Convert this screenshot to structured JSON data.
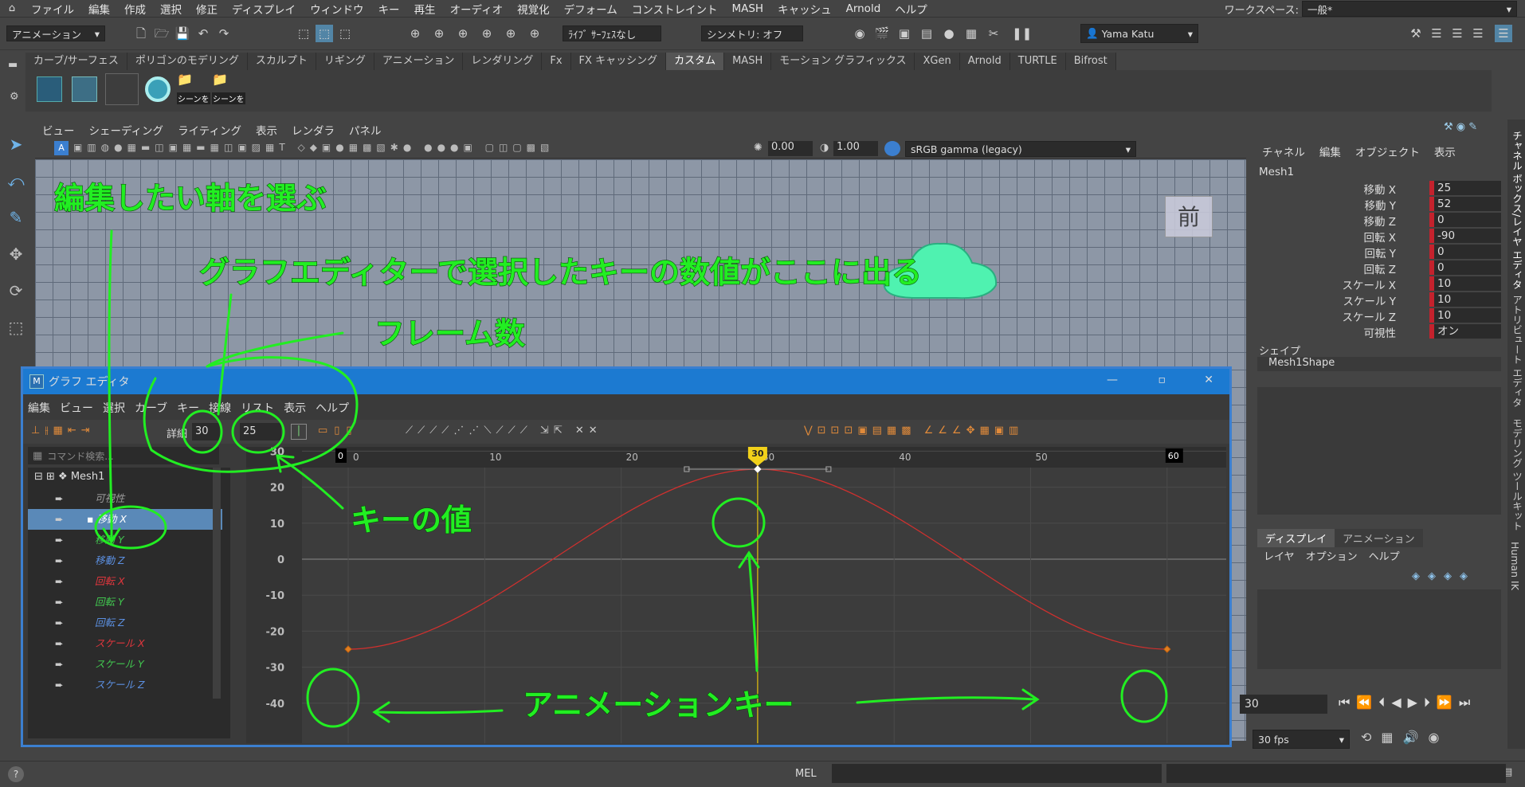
{
  "menubar": {
    "items": [
      "ファイル",
      "編集",
      "作成",
      "選択",
      "修正",
      "ディスプレイ",
      "ウィンドウ",
      "キー",
      "再生",
      "オーディオ",
      "視覚化",
      "デフォーム",
      "コンストレイント",
      "MASH",
      "キャッシュ",
      "Arnold",
      "ヘルプ"
    ],
    "workspace_label": "ワークスペース:",
    "workspace_value": "一般*"
  },
  "toolbar": {
    "mode": "アニメーション",
    "live": "ﾗｲﾌﾞ ｻｰﾌｪｽなし",
    "symmetry": "シンメトリ: オフ",
    "user": "Yama Katu"
  },
  "shelf": {
    "tabs": [
      "カーブ/サーフェス",
      "ポリゴンのモデリング",
      "スカルプト",
      "リギング",
      "アニメーション",
      "レンダリング",
      "Fx",
      "FX キャッシング",
      "カスタム",
      "MASH",
      "モーション グラフィックス",
      "XGen",
      "Arnold",
      "TURTLE",
      "Bifrost"
    ],
    "active": "カスタム",
    "icon_labels": [
      "シーンを",
      "シーンを"
    ]
  },
  "viewport": {
    "menu": [
      "ビュー",
      "シェーディング",
      "ライティング",
      "表示",
      "レンダラ",
      "パネル"
    ],
    "exposure": "0.00",
    "gamma": "1.00",
    "colorspace": "sRGB gamma (legacy)",
    "view_label": "前"
  },
  "graph_editor": {
    "title": "グラフ エディタ",
    "menu": [
      "編集",
      "ビュー",
      "選択",
      "カーブ",
      "キー",
      "接線",
      "リスト",
      "表示",
      "ヘルプ"
    ],
    "detail_label": "詳細",
    "frame_value": "30",
    "key_value": "25",
    "search_placeholder": "コマンド検索...",
    "tree": {
      "root": "Mesh1",
      "items": [
        {
          "label": "可視性",
          "color": "#9a9a9a",
          "selected": false
        },
        {
          "label": "移動 X",
          "color": "#ffffff",
          "selected": true
        },
        {
          "label": "移動 Y",
          "color": "#41c74f",
          "selected": false
        },
        {
          "label": "移動 Z",
          "color": "#5b8fe0",
          "selected": false
        },
        {
          "label": "回転 X",
          "color": "#e0363d",
          "selected": false
        },
        {
          "label": "回転 Y",
          "color": "#41c74f",
          "selected": false
        },
        {
          "label": "回転 Z",
          "color": "#5b8fe0",
          "selected": false
        },
        {
          "label": "スケール X",
          "color": "#e0363d",
          "selected": false
        },
        {
          "label": "スケール Y",
          "color": "#41c74f",
          "selected": false
        },
        {
          "label": "スケール Z",
          "color": "#5b8fe0",
          "selected": false
        }
      ]
    },
    "x_ticks": [
      "0",
      "10",
      "20",
      "30",
      "40",
      "50"
    ],
    "y_ticks": [
      "30",
      "20",
      "10",
      "0",
      "-10",
      "-20",
      "-30",
      "-40"
    ],
    "current_frame": "30",
    "start_marker": "0",
    "end_marker": "60",
    "keys": [
      {
        "frame": 0,
        "value": -25
      },
      {
        "frame": 30,
        "value": 25
      },
      {
        "frame": 60,
        "value": -25
      }
    ]
  },
  "channel_box": {
    "menu": [
      "チャネル",
      "編集",
      "オブジェクト",
      "表示"
    ],
    "object": "Mesh1",
    "attrs": [
      {
        "label": "移動 X",
        "value": "25"
      },
      {
        "label": "移動 Y",
        "value": "52"
      },
      {
        "label": "移動 Z",
        "value": "0"
      },
      {
        "label": "回転 X",
        "value": "-90"
      },
      {
        "label": "回転 Y",
        "value": "0"
      },
      {
        "label": "回転 Z",
        "value": "0"
      },
      {
        "label": "スケール X",
        "value": "10"
      },
      {
        "label": "スケール Y",
        "value": "10"
      },
      {
        "label": "スケール Z",
        "value": "10"
      },
      {
        "label": "可視性",
        "value": "オン"
      }
    ],
    "shape_label": "シェイプ",
    "shape": "Mesh1Shape",
    "layer_tabs": [
      "ディスプレイ",
      "アニメーション"
    ],
    "layer_menu": [
      "レイヤ",
      "オプション",
      "ヘルプ"
    ]
  },
  "side_tabs": [
    "チャネル ボックス/レイヤ エディタ",
    "アトリビュート エディタ",
    "モデリング ツールキット",
    "Human IK"
  ],
  "playback": {
    "current": "30",
    "fps": "30 fps"
  },
  "status": {
    "mel": "MEL"
  },
  "annotations": {
    "axis": "編集したい軸を選ぶ",
    "value_shown": "グラフエディターで選択したキーの数値がここに出る",
    "frames": "フレーム数",
    "key_value": "キーの値",
    "anim_keys": "アニメーションキー"
  }
}
